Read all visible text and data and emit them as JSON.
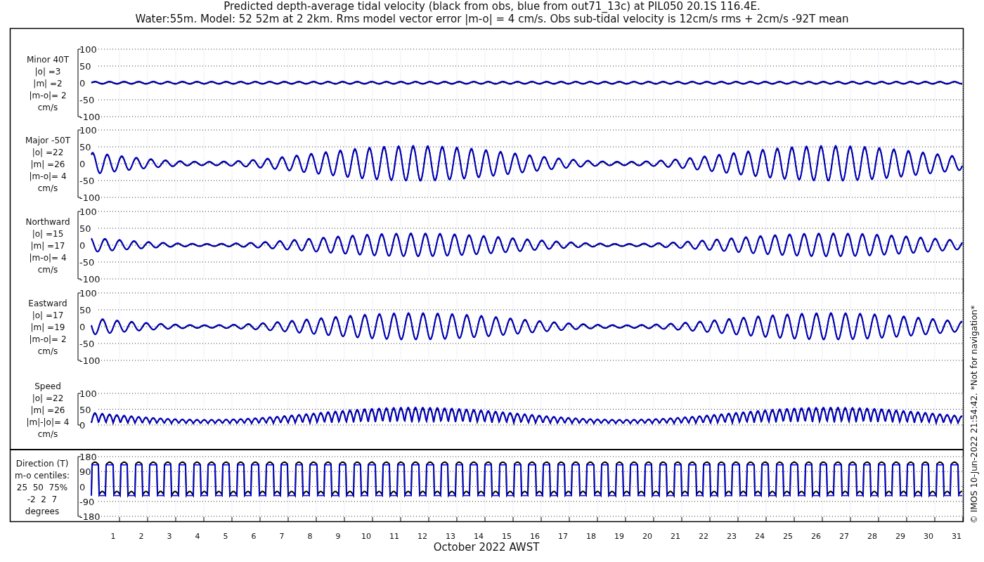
{
  "title_lines": [
    "Predicted depth-average tidal velocity (black from obs, blue from out71_13c) at PIL050 20.1S 116.4E.",
    "Water:55m. Model: 52 52m at 2 2km. Rms model vector error |m-o| = 4 cm/s. Obs sub-tidal velocity is 12cm/s rms + 2cm/s -92T mean"
  ],
  "panels": [
    {
      "kind": "velocity",
      "label_lines": [
        "Minor 40T",
        "|o| =3",
        "|m| =2",
        "|m-o|= 2",
        "cm/s"
      ],
      "yticks": [
        "100",
        "50",
        "0",
        "-50",
        "-100"
      ]
    },
    {
      "kind": "velocity",
      "label_lines": [
        "Major -50T",
        "|o| =22",
        "|m| =26",
        "|m-o|= 4",
        "cm/s"
      ],
      "yticks": [
        "100",
        "50",
        "0",
        "-50",
        "-100"
      ]
    },
    {
      "kind": "velocity",
      "label_lines": [
        "Northward",
        "|o| =15",
        "|m| =17",
        "|m-o|= 4",
        "cm/s"
      ],
      "yticks": [
        "100",
        "50",
        "0",
        "-50",
        "-100"
      ]
    },
    {
      "kind": "velocity",
      "label_lines": [
        "Eastward",
        "|o| =17",
        "|m| =19",
        "|m-o|= 2",
        "cm/s"
      ],
      "yticks": [
        "100",
        "50",
        "0",
        "-50",
        "-100"
      ]
    },
    {
      "kind": "speed",
      "label_lines": [
        "Speed",
        "|o| =22",
        "|m| =26",
        "|m|-|o|= 4",
        "cm/s"
      ],
      "yticks": [
        "100",
        "50",
        "0"
      ]
    },
    {
      "kind": "direction",
      "label_lines": [
        "Direction (T)",
        "m-o centiles:",
        "25  50  75%",
        "-2  2  7",
        "degrees"
      ],
      "yticks": [
        "180",
        "90",
        "0",
        "-90",
        "-180"
      ]
    }
  ],
  "xtick_labels": [
    "1",
    "2",
    "3",
    "4",
    "5",
    "6",
    "7",
    "8",
    "9",
    "10",
    "11",
    "12",
    "13",
    "14",
    "15",
    "16",
    "17",
    "18",
    "19",
    "20",
    "21",
    "22",
    "23",
    "24",
    "25",
    "26",
    "27",
    "28",
    "29",
    "30",
    "31"
  ],
  "xlabel": "October 2022 AWST",
  "credit": "© IMOS 10-Jun-2022 21:54:42. *Not for navigation*"
}
